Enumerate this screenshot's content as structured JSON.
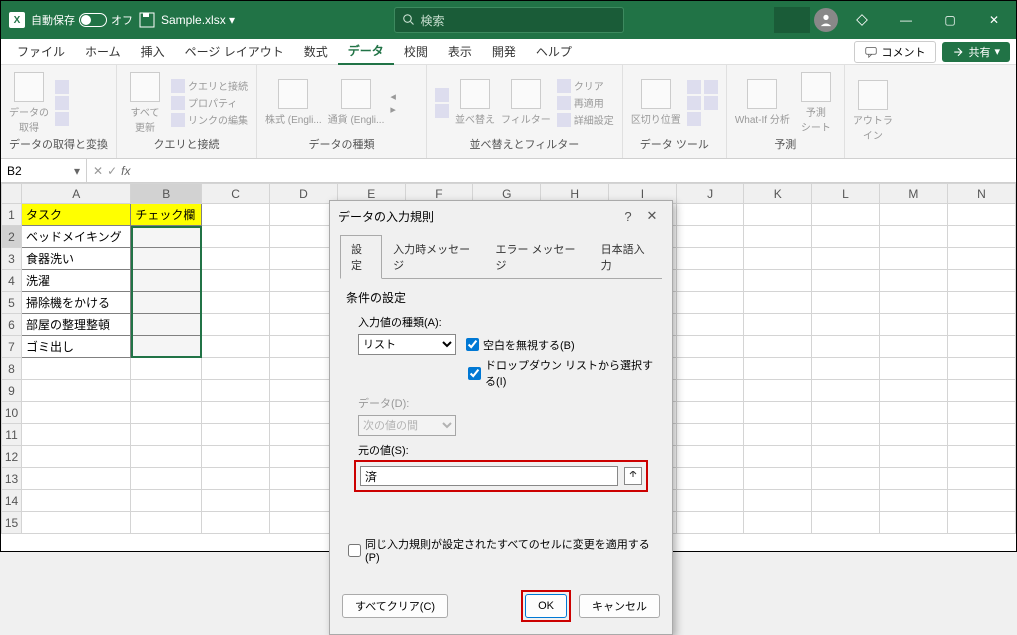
{
  "app": {
    "autosave_label": "自動保存",
    "autosave_state": "オフ",
    "filename": "Sample.xlsx ▾",
    "search_placeholder": "検索"
  },
  "window_buttons": {
    "min": "—",
    "restore": "▢",
    "close": "✕"
  },
  "menu": {
    "tabs": [
      "ファイル",
      "ホーム",
      "挿入",
      "ページ レイアウト",
      "数式",
      "データ",
      "校閲",
      "表示",
      "開発",
      "ヘルプ"
    ],
    "active_index": 5,
    "comment": "コメント",
    "share": "共有"
  },
  "ribbon": {
    "g1": {
      "label": "データの取得と変換",
      "get": "データの\n取得"
    },
    "g2": {
      "label": "クエリと接続",
      "refresh": "すべて\n更新",
      "sub1": "クエリと接続",
      "sub2": "プロパティ",
      "sub3": "リンクの編集"
    },
    "g3": {
      "label": "データの種類",
      "a": "株式 (Engli...",
      "b": "通貨 (Engli..."
    },
    "g4": {
      "label": "並べ替えとフィルター",
      "sort": "並べ替え",
      "filter": "フィルター",
      "sub1": "クリア",
      "sub2": "再適用",
      "sub3": "詳細設定"
    },
    "g5": {
      "label": "データ ツール",
      "split": "区切り位置"
    },
    "g6": {
      "label": "予測",
      "whatif": "What-If 分析",
      "forecast": "予測\nシート",
      "outline": "アウトラ\nイン"
    }
  },
  "formula": {
    "namebox": "B2",
    "fx": "fx"
  },
  "columns": [
    "A",
    "B",
    "C",
    "D",
    "E",
    "F",
    "G",
    "H",
    "I",
    "J",
    "K",
    "L",
    "M",
    "N"
  ],
  "sheet_data": {
    "header_a": "タスク",
    "header_b": "チェック欄",
    "rows": [
      "ベッドメイキング",
      "食器洗い",
      "洗濯",
      "掃除機をかける",
      "部屋の整理整頓",
      "ゴミ出し"
    ]
  },
  "dialog": {
    "title": "データの入力規則",
    "tabs": [
      "設定",
      "入力時メッセージ",
      "エラー メッセージ",
      "日本語入力"
    ],
    "section": "条件の設定",
    "allow_label": "入力値の種類(A):",
    "allow_value": "リスト",
    "ignore_blank": "空白を無視する(B)",
    "dropdown": "ドロップダウン リストから選択する(I)",
    "data_label": "データ(D):",
    "data_value": "次の値の間",
    "source_label": "元の値(S):",
    "source_value": "済",
    "apply_all": "同じ入力規則が設定されたすべてのセルに変更を適用する(P)",
    "clear": "すべてクリア(C)",
    "ok": "OK",
    "cancel": "キャンセル"
  }
}
